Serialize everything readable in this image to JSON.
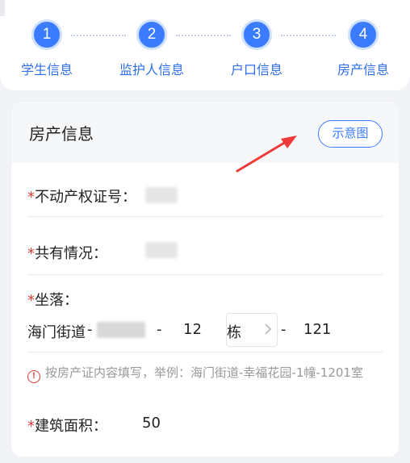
{
  "steps": [
    {
      "number": "1",
      "label": "学生信息"
    },
    {
      "number": "2",
      "label": "监护人信息"
    },
    {
      "number": "3",
      "label": "户口信息"
    },
    {
      "number": "4",
      "label": "房产信息"
    }
  ],
  "card": {
    "title": "房产信息",
    "diagram_button": "示意图"
  },
  "fields": {
    "required_mark": "*",
    "deed_label": "不动产权证号：",
    "ownership_label": "共有情况：",
    "location_label": "坐落：",
    "area_label": "建筑面积：",
    "area_value": "50"
  },
  "address": {
    "street": "海门街道",
    "sep1": "-",
    "sep2": "-",
    "building_no": "12",
    "building_unit": "栋",
    "sep3": "-",
    "room_no": "121"
  },
  "hint": "按房产证内容填写，举例：海门街道-幸福花园-1幢-1201室",
  "colors": {
    "accent": "#3a7bff",
    "required": "#e23a3a",
    "annotation_arrow": "#f03a3a"
  }
}
